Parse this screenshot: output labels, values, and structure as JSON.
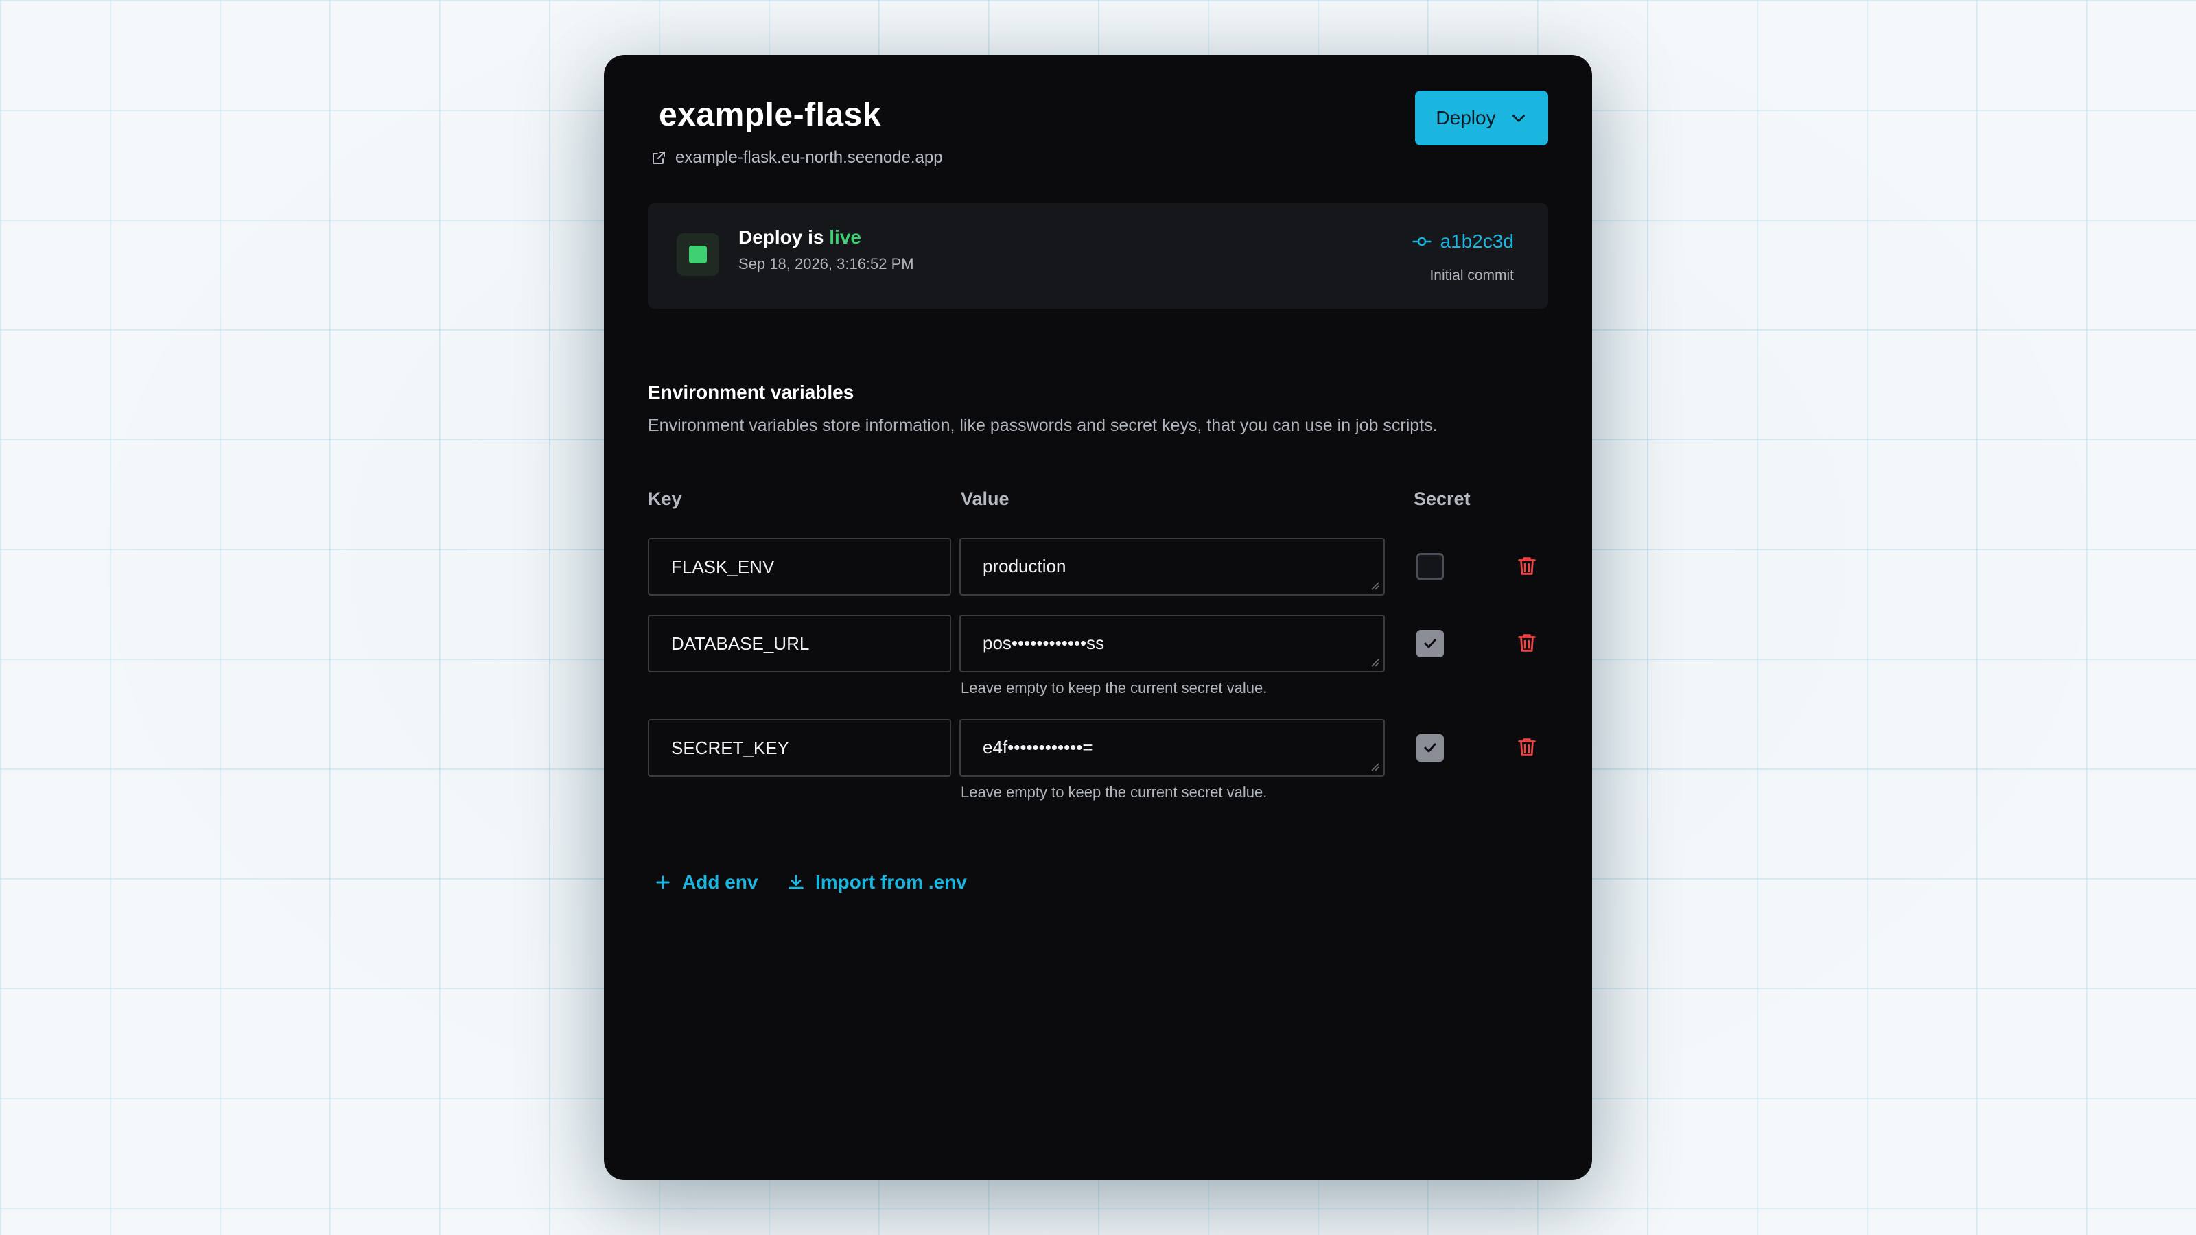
{
  "app": {
    "title": "example-flask",
    "url": "example-flask.eu-north.seenode.app",
    "deploy_button": "Deploy"
  },
  "deploy_status": {
    "prefix": "Deploy is",
    "state": "live",
    "timestamp": "Sep 18, 2026, 3:16:52 PM",
    "commit_hash": "a1b2c3d",
    "commit_message": "Initial commit",
    "status_color": "#3fd071"
  },
  "env": {
    "title": "Environment variables",
    "description": "Environment variables store information, like passwords and secret keys, that you can use in job scripts.",
    "columns": {
      "key": "Key",
      "value": "Value",
      "secret": "Secret"
    },
    "rows": [
      {
        "key": "FLASK_ENV",
        "value": "production",
        "secret": false,
        "hint": ""
      },
      {
        "key": "DATABASE_URL",
        "value": "pos••••••••••••ss",
        "secret": true,
        "hint": "Leave empty to keep the current secret value."
      },
      {
        "key": "SECRET_KEY",
        "value": "e4f••••••••••••=",
        "secret": true,
        "hint": "Leave empty to keep the current secret value."
      }
    ],
    "add_label": "Add env",
    "import_label": "Import from .env"
  },
  "colors": {
    "accent": "#1bb6e0",
    "danger": "#ef4444",
    "card_bg": "#0b0b0e"
  }
}
